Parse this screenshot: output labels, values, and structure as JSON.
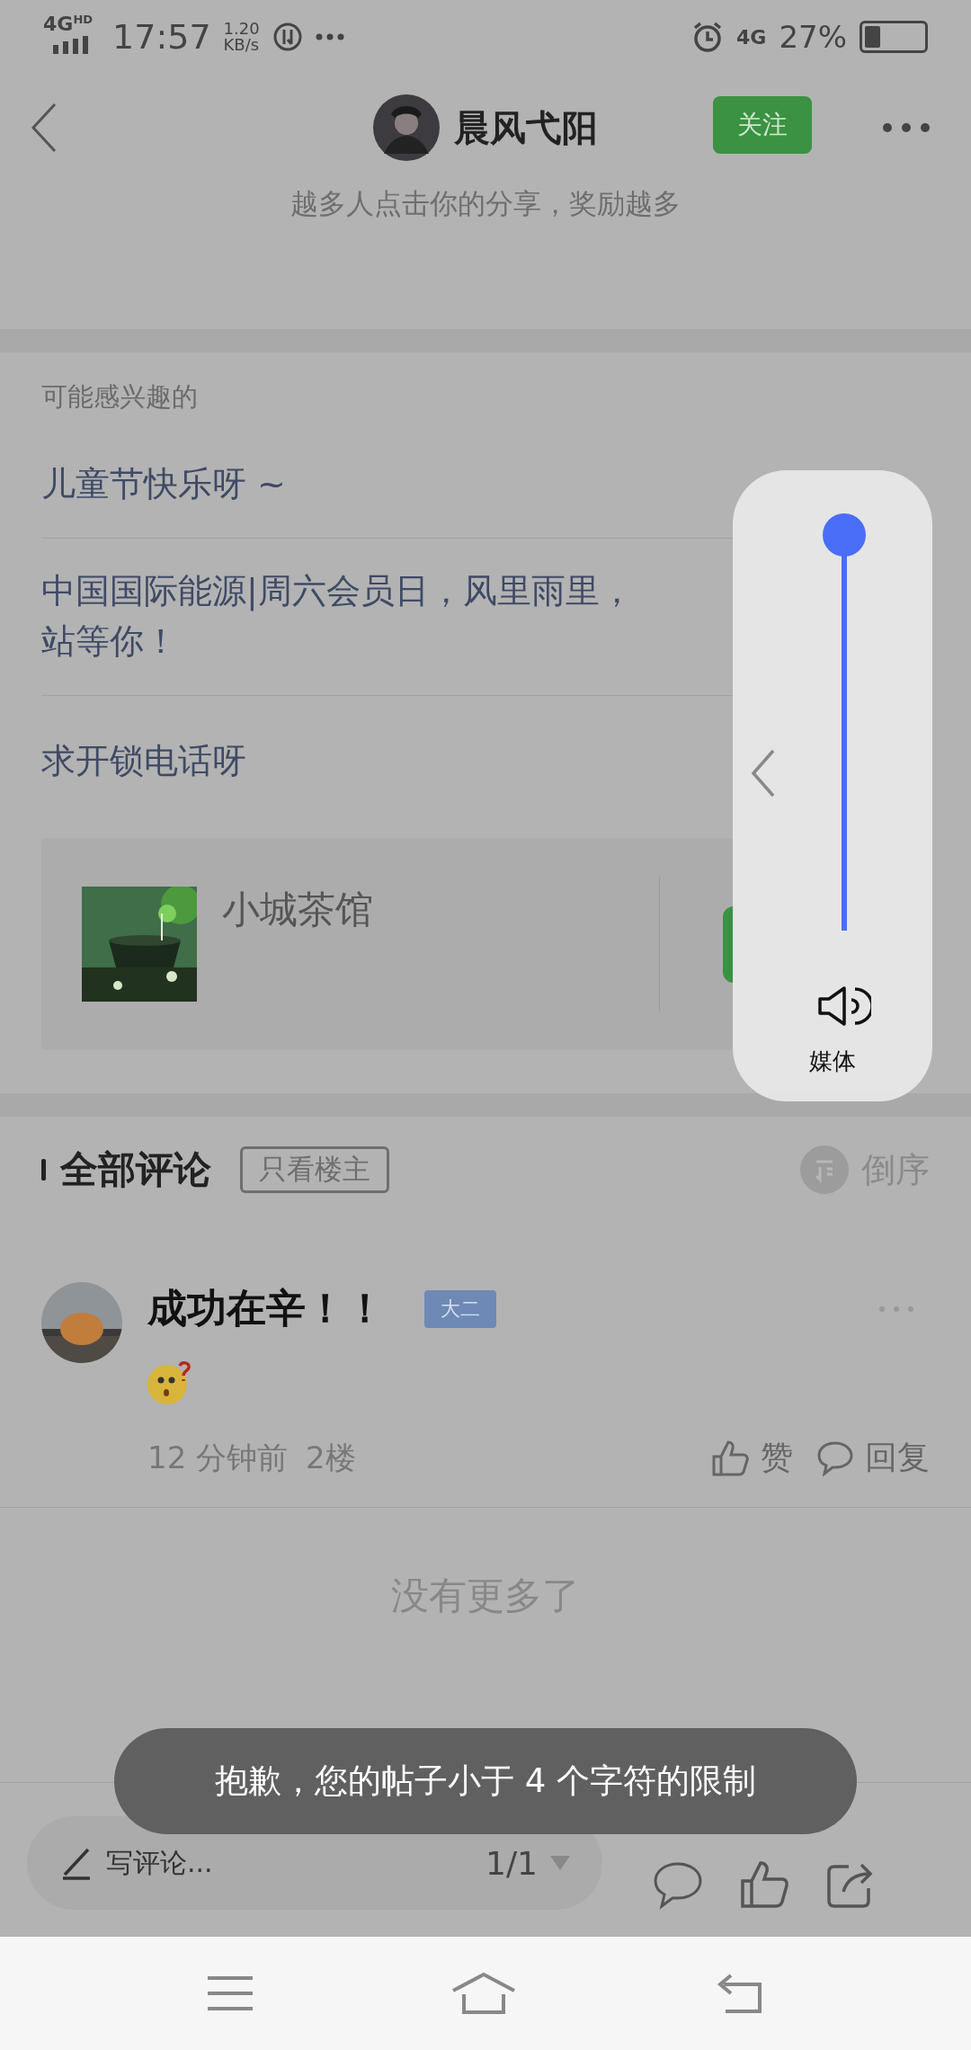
{
  "status_bar": {
    "network": "4G",
    "network_sup": "HD",
    "time": "17:57",
    "speed": "1.20",
    "speed_unit": "KB/s",
    "net2": "4G",
    "battery": "27%"
  },
  "header": {
    "username": "晨风弋阳",
    "follow_button": "关注",
    "subtitle": "越多人点击你的分享，奖励越多"
  },
  "interests": {
    "title": "可能感兴趣的",
    "items": [
      {
        "lines": [
          "儿童节快乐呀 ~"
        ]
      },
      {
        "lines": [
          "中国国际能源|周六会员日，风里雨里，",
          "站等你！"
        ]
      },
      {
        "lines": [
          "求开锁电话呀"
        ]
      }
    ]
  },
  "card": {
    "name": "小城茶馆"
  },
  "volume_panel": {
    "level": 1,
    "label": "媒体"
  },
  "comments": {
    "title": "全部评论",
    "filter": "只看楼主",
    "sort": "倒序",
    "items": [
      {
        "author": "成功在辛！！",
        "badge": "大二",
        "time": "12 分钟前",
        "floor": "2楼",
        "like": "赞",
        "reply": "回复"
      }
    ],
    "end_text": "没有更多了"
  },
  "bottom_bar": {
    "placeholder": "写评论...",
    "page": "1/1"
  },
  "toast": "抱歉，您的帖子小于 4 个字符的限制"
}
